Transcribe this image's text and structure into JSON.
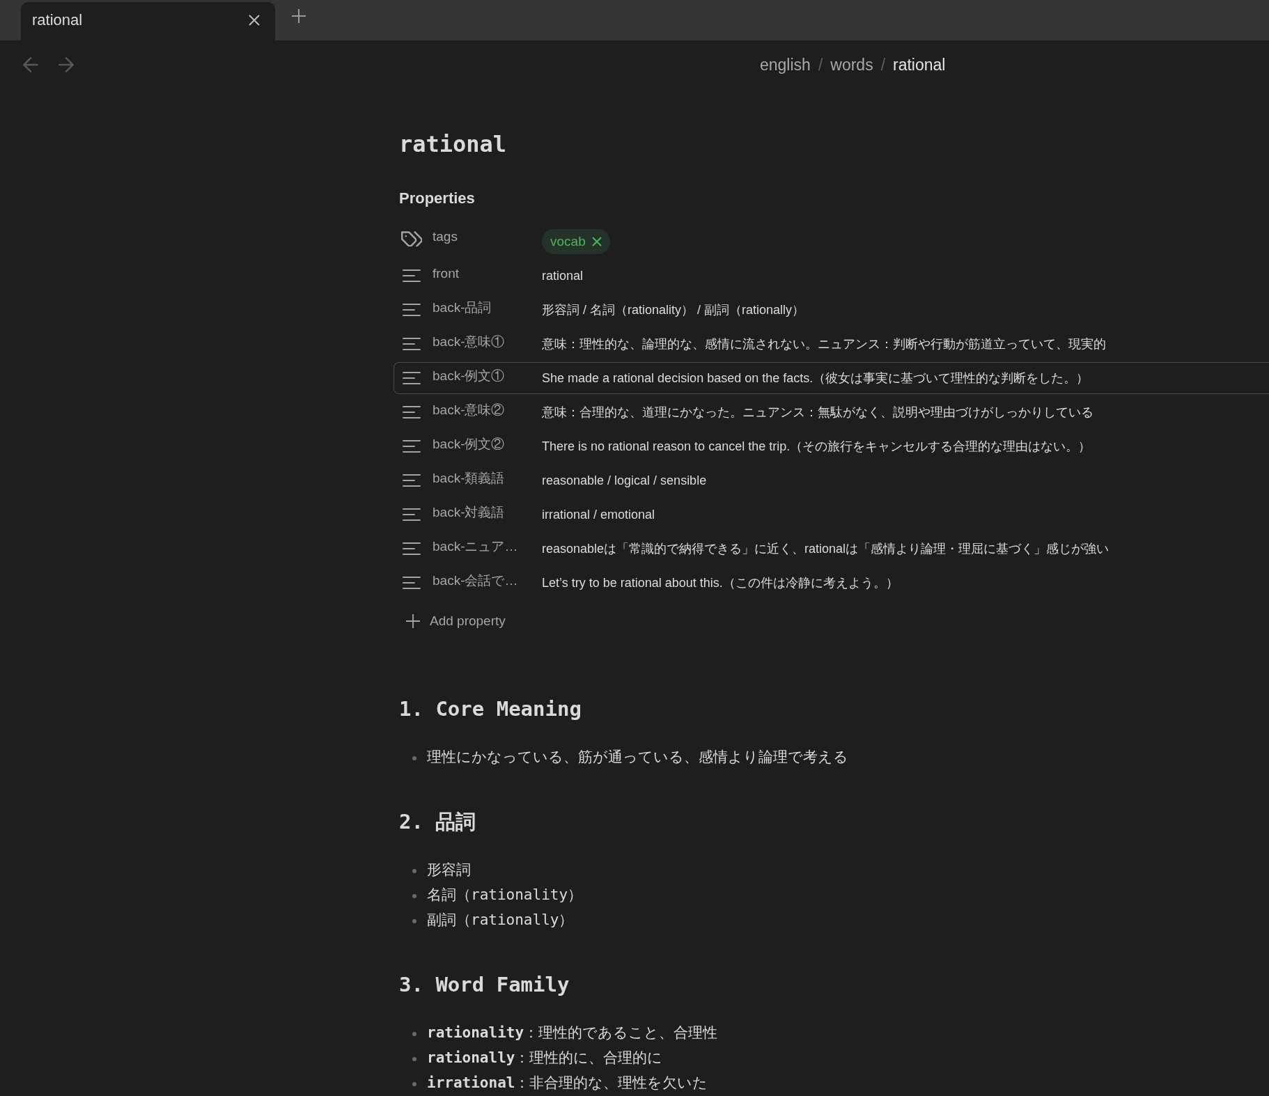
{
  "tabs": [
    {
      "title": "rational",
      "selected": true
    }
  ],
  "nav": [
    {
      "kind": "back",
      "disabled": true
    },
    {
      "kind": "forward",
      "disabled": true
    }
  ],
  "breadcrumb": [
    {
      "kind": "folder",
      "text": "english"
    },
    {
      "kind": "separator",
      "text": "/"
    },
    {
      "kind": "folder",
      "text": "words"
    },
    {
      "kind": "separator",
      "text": "/"
    },
    {
      "kind": "file",
      "text": "rational"
    }
  ],
  "note": {
    "title": "rational"
  },
  "properties": {
    "heading": "Properties",
    "rows": [
      {
        "kind": "tags",
        "label": "tags",
        "selected": false,
        "tags": [
          "vocab"
        ]
      },
      {
        "kind": "text",
        "label": "front",
        "value": "rational",
        "selected": false
      },
      {
        "kind": "text",
        "label": "back-品詞",
        "value": "形容詞 / 名詞（rationality） / 副詞（rationally）",
        "selected": false
      },
      {
        "kind": "text",
        "label": "back-意味①",
        "value": "意味：理性的な、論理的な、感情に流されない。ニュアンス：判断や行動が筋道立っていて、現実的",
        "selected": false
      },
      {
        "kind": "text",
        "label": "back-例文①",
        "value": "She made a rational decision based on the facts.（彼女は事実に基づいて理性的な判断をした。）",
        "selected": true
      },
      {
        "kind": "text",
        "label": "back-意味②",
        "value": "意味：合理的な、道理にかなった。ニュアンス：無駄がなく、説明や理由づけがしっかりしている",
        "selected": false
      },
      {
        "kind": "text",
        "label": "back-例文②",
        "value": "There is no rational reason to cancel the trip.（その旅行をキャンセルする合理的な理由はない。）",
        "selected": false
      },
      {
        "kind": "text",
        "label": "back-類義語",
        "value": "reasonable / logical / sensible",
        "selected": false
      },
      {
        "kind": "text",
        "label": "back-対義語",
        "value": "irrational / emotional",
        "selected": false
      },
      {
        "kind": "text",
        "label": "back-ニュア…",
        "value": "reasonableは「常識的で納得できる」に近く、rationalは「感情より論理・理屈に基づく」感じが強い",
        "selected": false
      },
      {
        "kind": "text",
        "label": "back-会話で…",
        "value": "Let’s try to be rational about this.（この件は冷静に考えよう。）",
        "selected": false
      }
    ],
    "add_label": "Add property"
  },
  "sections": [
    {
      "heading": "1. Core Meaning",
      "items": [
        "理性にかなっている、筋が通っている、感情より論理で考える"
      ]
    },
    {
      "heading": "2. 品詞",
      "items": [
        "形容詞",
        "名詞（rationality）",
        "副詞（rationally）"
      ]
    },
    {
      "heading": "3. Word Family",
      "items": [
        "**rationality**：理性的であること、合理性",
        "**rationally**：理性的に、合理的に",
        "**irrational**：非合理的な、理性を欠いた"
      ]
    }
  ]
}
